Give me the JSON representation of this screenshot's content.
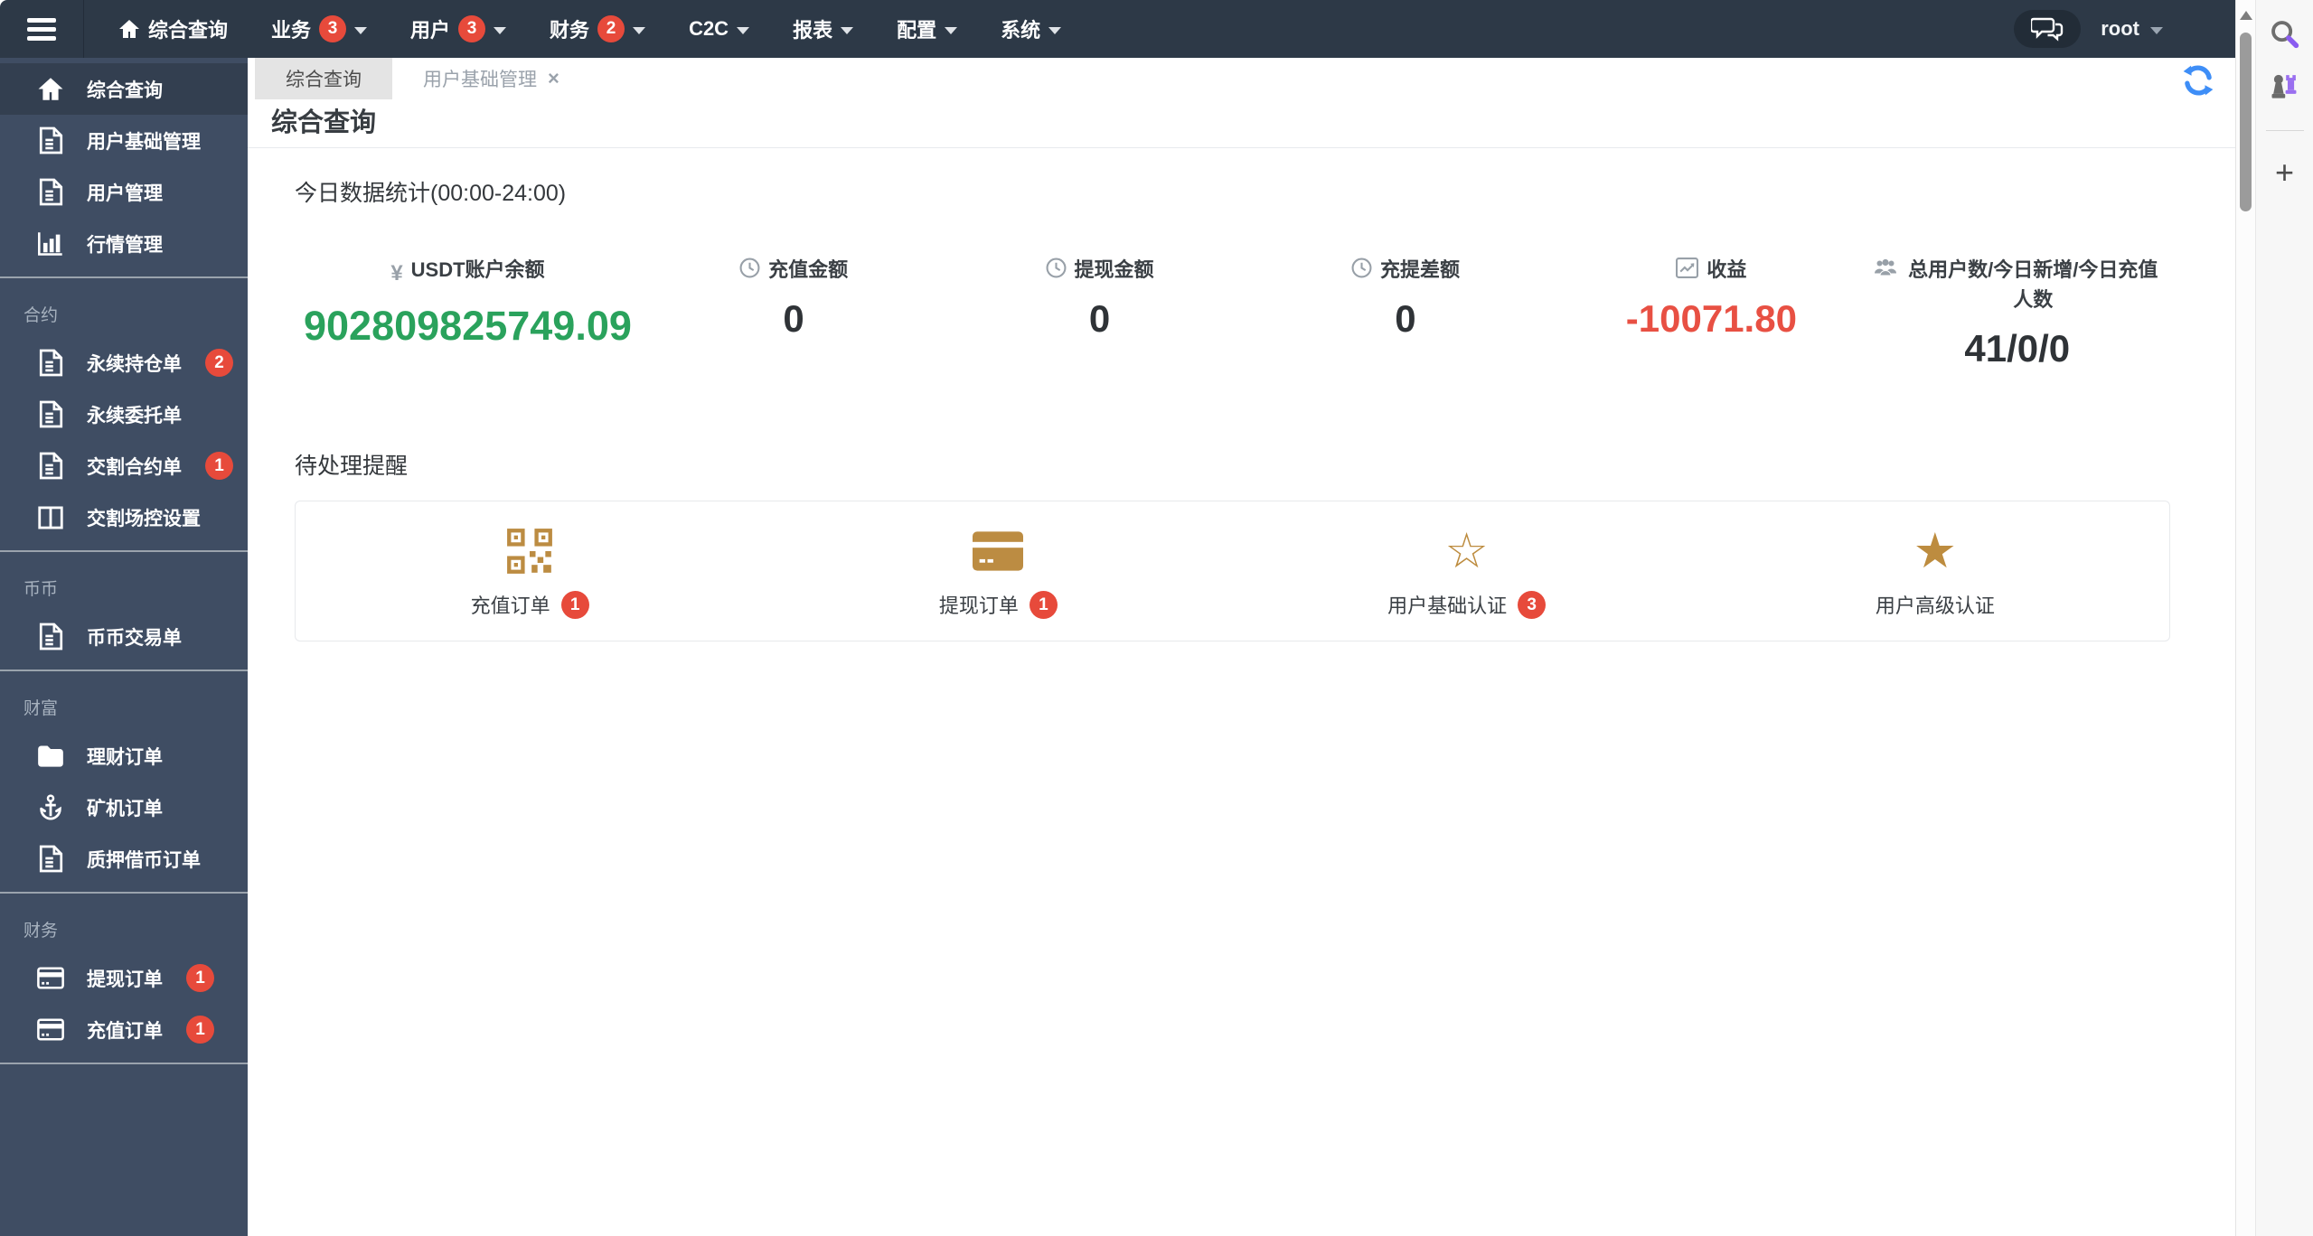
{
  "navbar": {
    "items": [
      {
        "label": "综合查询"
      },
      {
        "label": "业务",
        "badge": "3"
      },
      {
        "label": "用户",
        "badge": "3"
      },
      {
        "label": "财务",
        "badge": "2"
      },
      {
        "label": "C2C"
      },
      {
        "label": "报表"
      },
      {
        "label": "配置"
      },
      {
        "label": "系统"
      }
    ],
    "username": "root"
  },
  "sidebar": {
    "sections": [
      {
        "items": [
          {
            "label": "综合查询"
          },
          {
            "label": "用户基础管理"
          },
          {
            "label": "用户管理"
          },
          {
            "label": "行情管理"
          }
        ]
      },
      {
        "header": "合约",
        "items": [
          {
            "label": "永续持仓单",
            "badge": "2"
          },
          {
            "label": "永续委托单"
          },
          {
            "label": "交割合约单",
            "badge": "1"
          },
          {
            "label": "交割场控设置"
          }
        ]
      },
      {
        "header": "币币",
        "items": [
          {
            "label": "币币交易单"
          }
        ]
      },
      {
        "header": "财富",
        "items": [
          {
            "label": "理财订单"
          },
          {
            "label": "矿机订单"
          },
          {
            "label": "质押借币订单"
          }
        ]
      },
      {
        "header": "财务",
        "items": [
          {
            "label": "提现订单",
            "badge": "1"
          },
          {
            "label": "充值订单",
            "badge": "1"
          }
        ]
      }
    ]
  },
  "tabs": [
    {
      "label": "综合查询"
    },
    {
      "label": "用户基础管理"
    }
  ],
  "page": {
    "title": "综合查询"
  },
  "today_stats": {
    "heading": "今日数据统计(00:00-24:00)",
    "items": [
      {
        "label": "USDT账户余额",
        "value": "902809825749.09"
      },
      {
        "label": "充值金额",
        "value": "0"
      },
      {
        "label": "提现金额",
        "value": "0"
      },
      {
        "label": "充提差额",
        "value": "0"
      },
      {
        "label": "收益",
        "value": "-10071.80"
      },
      {
        "label": "总用户数/今日新增/今日充值人数",
        "value": "41/0/0"
      }
    ]
  },
  "reminders": {
    "heading": "待处理提醒",
    "items": [
      {
        "label": "充值订单",
        "badge": "1"
      },
      {
        "label": "提现订单",
        "badge": "1"
      },
      {
        "label": "用户基础认证",
        "badge": "3"
      },
      {
        "label": "用户高级认证"
      }
    ]
  },
  "icons": {
    "yen": "¥",
    "star_outline": "☆",
    "star_filled": "★",
    "close": "×",
    "plus": "+"
  },
  "colors": {
    "navbar_bg": "#2d3947",
    "sidebar_bg": "#3f4d63",
    "badge_red": "#e74a3b",
    "value_green": "#2aa25c",
    "value_red": "#e85043",
    "reminder_tan": "#bc8c42",
    "refresh_blue": "#3e8ef7"
  }
}
